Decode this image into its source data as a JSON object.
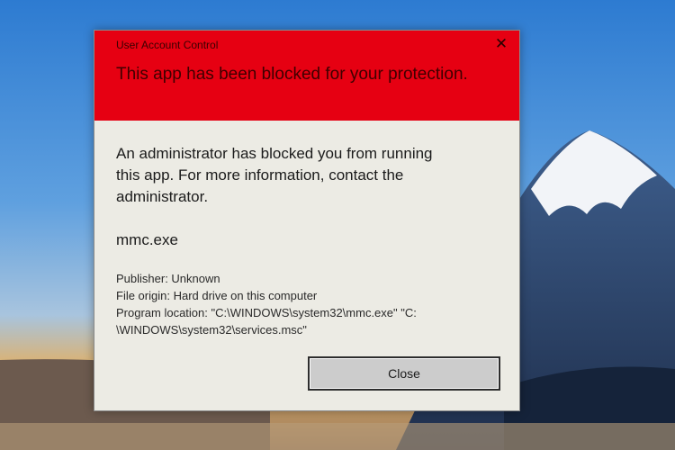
{
  "dialog": {
    "caption": "User Account Control",
    "close_glyph": "✕",
    "title": "This app has been blocked for your protection.",
    "message": "An administrator has blocked you from running this app. For more information, contact the administrator.",
    "program_name": "mmc.exe",
    "details": {
      "publisher": "Publisher: Unknown",
      "file_origin": "File origin: Hard drive on this computer",
      "location_line1": "Program location: \"C:\\WINDOWS\\system32\\mmc.exe\" \"C:",
      "location_line2": "\\WINDOWS\\system32\\services.msc\""
    },
    "close_label": "Close"
  },
  "colors": {
    "header_red": "#e60012",
    "dialog_background": "#ecebe4",
    "button_background": "#cccccc"
  }
}
